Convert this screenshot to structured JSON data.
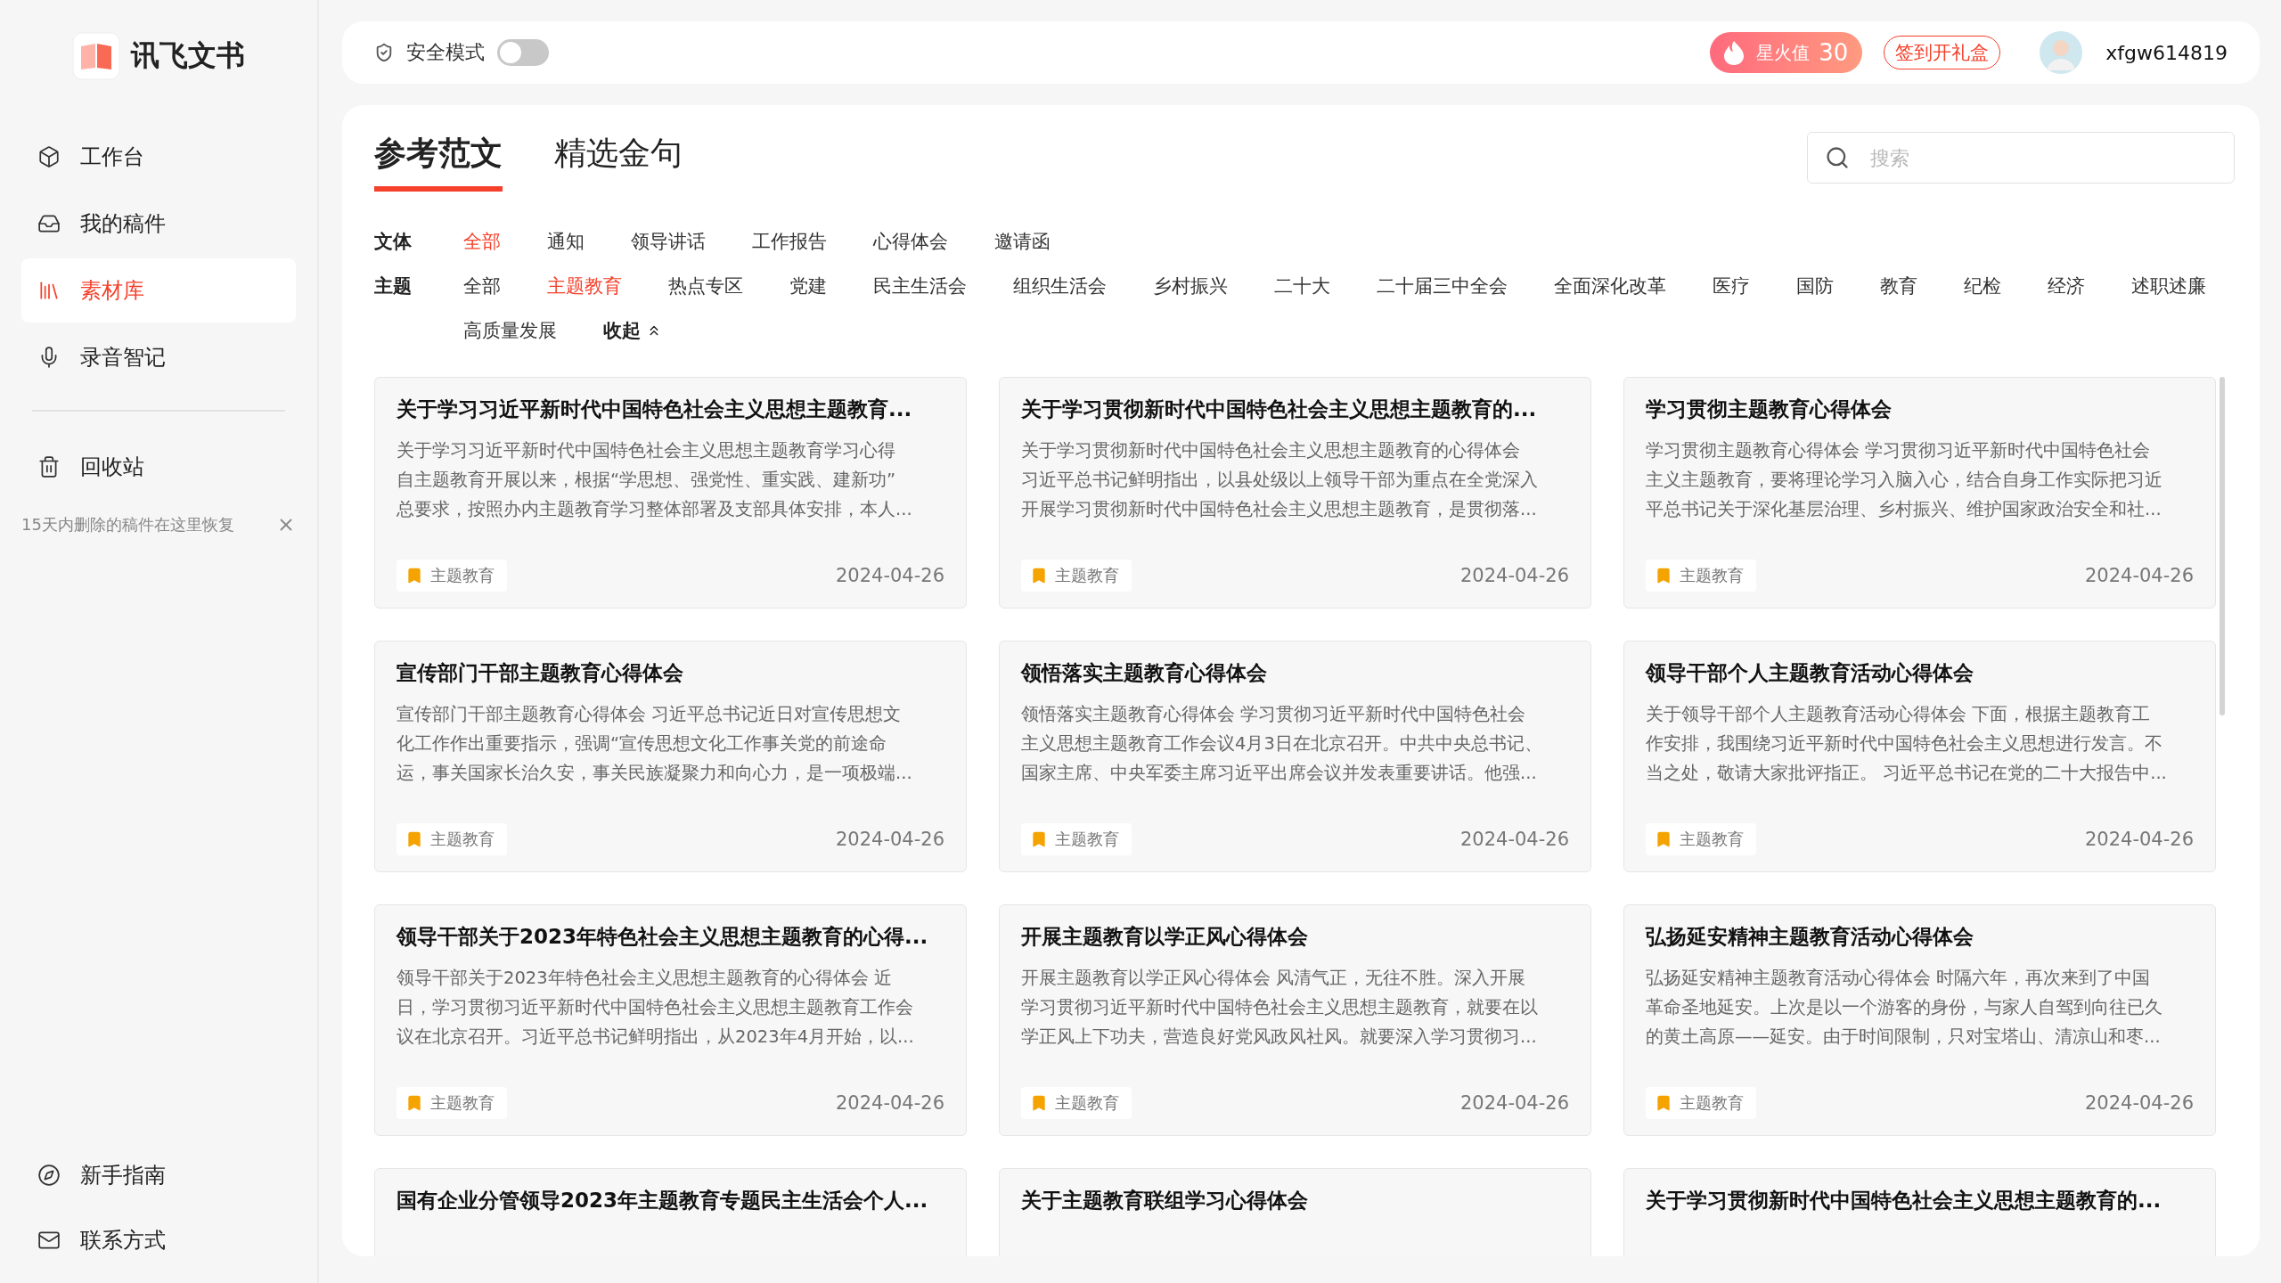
{
  "sidebar": {
    "logo": "讯飞文书",
    "items": [
      {
        "label": "工作台",
        "kind": "box",
        "selected": false
      },
      {
        "label": "我的稿件",
        "kind": "tray",
        "selected": false
      },
      {
        "label": "素材库",
        "kind": "books",
        "selected": true
      },
      {
        "label": "录音智记",
        "kind": "mic",
        "selected": false
      }
    ],
    "trash": {
      "label": "回收站",
      "hint": "15天内删除的稿件在这里恢复"
    },
    "bottom_items": [
      {
        "label": "新手指南",
        "kind": "compass"
      },
      {
        "label": "联系方式",
        "kind": "mail"
      }
    ]
  },
  "top_bar": {
    "safe_mode": {
      "label": "安全模式",
      "on": false
    },
    "spark": {
      "label": "星火值",
      "value": "30"
    },
    "checkin": "签到开礼盒",
    "username": "xfgw614819"
  },
  "tabs": [
    {
      "label": "参考范文",
      "selected": true
    },
    {
      "label": "精选金句",
      "selected": false
    }
  ],
  "search": {
    "placeholder": "搜索"
  },
  "filters": [
    {
      "label": "文体",
      "options": [
        {
          "label": "全部",
          "selected": true
        },
        {
          "label": "通知",
          "selected": false
        },
        {
          "label": "领导讲话",
          "selected": false
        },
        {
          "label": "工作报告",
          "selected": false
        },
        {
          "label": "心得体会",
          "selected": false
        },
        {
          "label": "邀请函",
          "selected": false
        }
      ]
    },
    {
      "label": "主题",
      "options": [
        {
          "label": "全部",
          "selected": false
        },
        {
          "label": "主题教育",
          "selected": true
        },
        {
          "label": "热点专区",
          "selected": false
        },
        {
          "label": "党建",
          "selected": false
        },
        {
          "label": "民主生活会",
          "selected": false
        },
        {
          "label": "组织生活会",
          "selected": false
        },
        {
          "label": "乡村振兴",
          "selected": false
        },
        {
          "label": "二十大",
          "selected": false
        },
        {
          "label": "二十届三中全会",
          "selected": false
        },
        {
          "label": "全面深化改革",
          "selected": false
        },
        {
          "label": "医疗",
          "selected": false
        },
        {
          "label": "国防",
          "selected": false
        },
        {
          "label": "教育",
          "selected": false
        },
        {
          "label": "纪检",
          "selected": false
        },
        {
          "label": "经济",
          "selected": false
        },
        {
          "label": "述职述廉",
          "selected": false
        },
        {
          "label": "高质量发展",
          "selected": false
        }
      ],
      "collapse": "收起"
    }
  ],
  "cards": [
    {
      "title": "关于学习习近平新时代中国特色社会主义思想主题教育...",
      "excerpt": [
        "关于学习习近平新时代中国特色社会主义思想主题教育学习心得",
        "自主题教育开展以来，根据“学思想、强党性、重实践、建新功”",
        "总要求，按照办内主题教育学习整体部署及支部具体安排，本人..."
      ],
      "tag": "主题教育",
      "date": "2024-04-26"
    },
    {
      "title": "关于学习贯彻新时代中国特色社会主义思想主题教育的...",
      "excerpt": [
        "关于学习贯彻新时代中国特色社会主义思想主题教育的心得体会",
        "习近平总书记鲜明指出，以县处级以上领导干部为重点在全党深入",
        "开展学习贯彻新时代中国特色社会主义思想主题教育，是贯彻落..."
      ],
      "tag": "主题教育",
      "date": "2024-04-26"
    },
    {
      "title": "学习贯彻主题教育心得体会",
      "excerpt": [
        "学习贯彻主题教育心得体会 学习贯彻习近平新时代中国特色社会",
        "主义主题教育，要将理论学习入脑入心，结合自身工作实际把习近",
        "平总书记关于深化基层治理、乡村振兴、维护国家政治安全和社..."
      ],
      "tag": "主题教育",
      "date": "2024-04-26"
    },
    {
      "title": "宣传部门干部主题教育心得体会",
      "excerpt": [
        "宣传部门干部主题教育心得体会 习近平总书记近日对宣传思想文",
        "化工作作出重要指示，强调“宣传思想文化工作事关党的前途命",
        "运，事关国家长治久安，事关民族凝聚力和向心力，是一项极端..."
      ],
      "tag": "主题教育",
      "date": "2024-04-26"
    },
    {
      "title": "领悟落实主题教育心得体会",
      "excerpt": [
        "领悟落实主题教育心得体会 学习贯彻习近平新时代中国特色社会",
        "主义思想主题教育工作会议4月3日在北京召开。中共中央总书记、",
        "国家主席、中央军委主席习近平出席会议并发表重要讲话。他强..."
      ],
      "tag": "主题教育",
      "date": "2024-04-26"
    },
    {
      "title": "领导干部个人主题教育活动心得体会",
      "excerpt": [
        "关于领导干部个人主题教育活动心得体会 下面，根据主题教育工",
        "作安排，我围绕习近平新时代中国特色社会主义思想进行发言。不",
        "当之处，敬请大家批评指正。 习近平总书记在党的二十大报告中..."
      ],
      "tag": "主题教育",
      "date": "2024-04-26"
    },
    {
      "title": "领导干部关于2023年特色社会主义思想主题教育的心得...",
      "excerpt": [
        "领导干部关于2023年特色社会主义思想主题教育的心得体会 近",
        "日，学习贯彻习近平新时代中国特色社会主义思想主题教育工作会",
        "议在北京召开。习近平总书记鲜明指出，从2023年4月开始，以..."
      ],
      "tag": "主题教育",
      "date": "2024-04-26"
    },
    {
      "title": "开展主题教育以学正风心得体会",
      "excerpt": [
        "开展主题教育以学正风心得体会 风清气正，无往不胜。深入开展",
        "学习贯彻习近平新时代中国特色社会主义思想主题教育，就要在以",
        "学正风上下功夫，营造良好党风政风社风。就要深入学习贯彻习..."
      ],
      "tag": "主题教育",
      "date": "2024-04-26"
    },
    {
      "title": "弘扬延安精神主题教育活动心得体会",
      "excerpt": [
        "弘扬延安精神主题教育活动心得体会 时隔六年，再次来到了中国",
        "革命圣地延安。上次是以一个游客的身份，与家人自驾到向往已久",
        "的黄土高原——延安。由于时间限制，只对宝塔山、清凉山和枣..."
      ],
      "tag": "主题教育",
      "date": "2024-04-26"
    },
    {
      "title": "国有企业分管领导2023年主题教育专题民主生活会个人..."
    },
    {
      "title": "关于主题教育联组学习心得体会"
    },
    {
      "title": "关于学习贯彻新时代中国特色社会主义思想主题教育的..."
    }
  ]
}
